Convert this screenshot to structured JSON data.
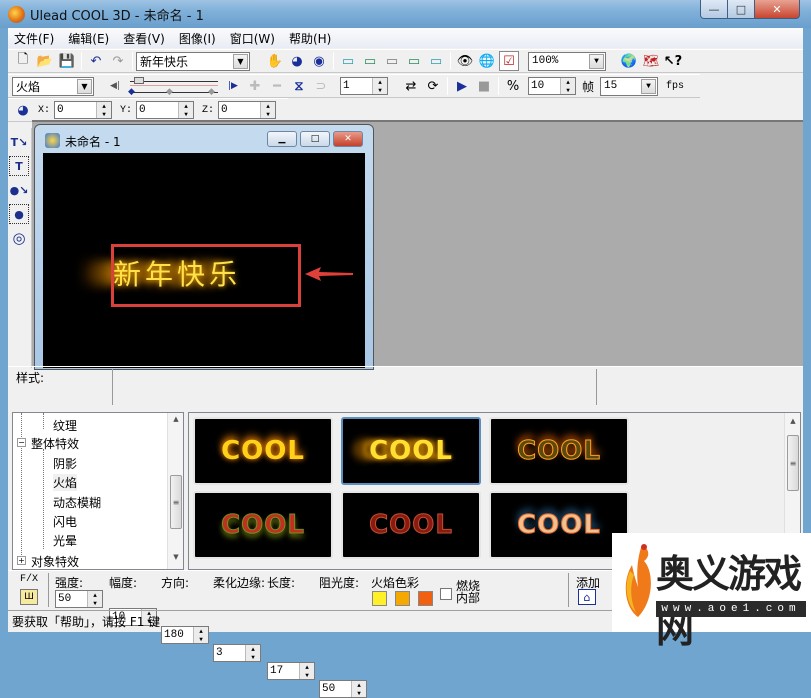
{
  "window": {
    "title": "Ulead COOL 3D - 未命名 - 1",
    "min_label": "—",
    "max_label": "□",
    "close_label": "✕"
  },
  "menu": [
    "文件(F)",
    "编辑(E)",
    "查看(V)",
    "图像(I)",
    "窗口(W)",
    "帮助(H)"
  ],
  "toolbar1": {
    "text_combo_value": "新年快乐",
    "zoom_combo_value": "100%"
  },
  "toolbar2": {
    "effect_combo_value": "火焰",
    "frame_spin_value": "1",
    "frames_spin_value": "10",
    "frames_label": "帧",
    "fps_value": "15",
    "fps_label": "fps"
  },
  "toolbar3": {
    "x_label": "X:",
    "x_value": "0",
    "y_label": "Y:",
    "y_value": "0",
    "z_label": "Z:",
    "z_value": "0"
  },
  "document": {
    "title": "未命名 - 1",
    "canvas_text": "新年快乐",
    "highlight_color": "#d9413a"
  },
  "stylebar": {
    "label": "样式:"
  },
  "tree": {
    "items": [
      {
        "label": "纹理",
        "level": 2
      },
      {
        "label": "整体特效",
        "level": 1,
        "expanded": true
      },
      {
        "label": "阴影",
        "level": 2
      },
      {
        "label": "火焰",
        "level": 2,
        "selected": true
      },
      {
        "label": "动态模糊",
        "level": 2
      },
      {
        "label": "闪电",
        "level": 2
      },
      {
        "label": "光晕",
        "level": 2
      },
      {
        "label": "对象特效",
        "level": 1,
        "expanded": false
      }
    ]
  },
  "gallery": {
    "thumbnails": [
      {
        "text": "COOL",
        "style": "yellow-fire"
      },
      {
        "text": "COOL",
        "style": "motion-fire",
        "selected": true
      },
      {
        "text": "COOL",
        "style": "outline-fire"
      },
      {
        "text": "COOL",
        "style": "red-green-fire"
      },
      {
        "text": "COOL",
        "style": "dark-red-fire"
      },
      {
        "text": "COOL",
        "style": "blue-fire"
      }
    ]
  },
  "params": {
    "fx_label": "F/X",
    "fields": [
      {
        "label": "强度:",
        "value": "50"
      },
      {
        "label": "幅度:",
        "value": "10"
      },
      {
        "label": "方向:",
        "value": "180"
      },
      {
        "label": "柔化边缘:",
        "value": "3"
      },
      {
        "label": "长度:",
        "value": "17"
      },
      {
        "label": "阻光度:",
        "value": "50"
      }
    ],
    "flame_color_label": "火焰色彩",
    "flame_colors": [
      "#fff02a",
      "#f5a800",
      "#f06010"
    ],
    "burn_inside_label_1": "燃烧",
    "burn_inside_label_2": "内部",
    "burn_inside_checked": false,
    "add_label": "添加"
  },
  "status": {
    "text": "要获取「帮助」，请按 F1 键"
  },
  "watermark": {
    "title": "奥义游戏网",
    "url": "www.aoe1.com"
  }
}
